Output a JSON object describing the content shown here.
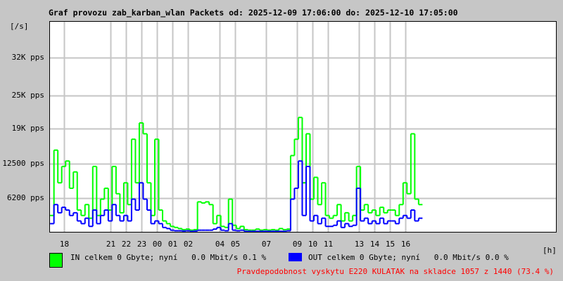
{
  "chart_data": {
    "type": "line",
    "title": "Graf provozu zab_karban_wlan Packets od: 2025-12-09 17:06:00 do: 2025-12-10 17:05:00",
    "ylabel": "[/s]",
    "xlabel": "[h]",
    "ylim": [
      0,
      38700
    ],
    "xlim_hours": [
      17.05,
      49.7
    ],
    "grid": true,
    "y_ticks": [
      {
        "value": 6200,
        "label": "6200 pps"
      },
      {
        "value": 12500,
        "label": "12500 pps"
      },
      {
        "value": 19000,
        "label": "19K pps"
      },
      {
        "value": 25000,
        "label": "25K pps"
      },
      {
        "value": 32000,
        "label": "32K pps"
      }
    ],
    "x_ticks": [
      {
        "value": 18,
        "label": "18"
      },
      {
        "value": 21,
        "label": "21"
      },
      {
        "value": 22,
        "label": "22"
      },
      {
        "value": 23,
        "label": "23"
      },
      {
        "value": 24,
        "label": "00"
      },
      {
        "value": 25,
        "label": "01"
      },
      {
        "value": 26,
        "label": "02"
      },
      {
        "value": 28,
        "label": "04"
      },
      {
        "value": 29,
        "label": "05"
      },
      {
        "value": 31,
        "label": "07"
      },
      {
        "value": 33,
        "label": "09"
      },
      {
        "value": 34,
        "label": "10"
      },
      {
        "value": 35,
        "label": "11"
      },
      {
        "value": 37,
        "label": "13"
      },
      {
        "value": 38,
        "label": "14"
      },
      {
        "value": 39,
        "label": "15"
      },
      {
        "value": 40,
        "label": "16"
      }
    ],
    "sample_start_hour": 17.1,
    "sample_step_hours": 0.25,
    "series": [
      {
        "name": "IN",
        "color": "#00ff00",
        "values": [
          3000,
          15000,
          9000,
          12000,
          13000,
          8000,
          11000,
          4000,
          3000,
          5000,
          2500,
          12000,
          3000,
          6000,
          8000,
          4000,
          12000,
          7000,
          3500,
          9000,
          5000,
          17000,
          9000,
          20000,
          18000,
          9000,
          3000,
          17000,
          4000,
          2000,
          1500,
          1000,
          800,
          600,
          400,
          500,
          300,
          400,
          5500,
          5300,
          5500,
          5000,
          1500,
          3000,
          1000,
          800,
          6000,
          1200,
          600,
          1000,
          400,
          300,
          300,
          500,
          300,
          400,
          300,
          400,
          300,
          600,
          400,
          500,
          14000,
          17000,
          21000,
          9000,
          18000,
          6000,
          10000,
          5000,
          9000,
          3000,
          2500,
          3000,
          5000,
          2000,
          3500,
          2000,
          3000,
          12000,
          4000,
          5000,
          3500,
          4000,
          3000,
          4500,
          3500,
          4000,
          4000,
          3000,
          5000,
          9000,
          7000,
          18000,
          6000,
          5000
        ]
      },
      {
        "name": "OUT",
        "color": "#0000ff",
        "values": [
          1500,
          5000,
          3500,
          4500,
          4000,
          3000,
          3500,
          2000,
          1500,
          2500,
          1000,
          4000,
          1500,
          3000,
          4000,
          2000,
          5000,
          3000,
          2000,
          3000,
          2000,
          6000,
          4000,
          9000,
          6000,
          4000,
          1500,
          2000,
          1500,
          800,
          600,
          300,
          200,
          200,
          150,
          200,
          100,
          150,
          300,
          300,
          300,
          300,
          500,
          800,
          300,
          200,
          1500,
          300,
          200,
          300,
          100,
          100,
          100,
          100,
          100,
          100,
          100,
          100,
          100,
          100,
          100,
          200,
          6000,
          8000,
          13000,
          3000,
          12000,
          2000,
          3000,
          1500,
          2500,
          1000,
          1000,
          1200,
          2000,
          800,
          1500,
          1000,
          1200,
          8000,
          2000,
          2500,
          1500,
          2000,
          1500,
          2500,
          1500,
          2000,
          2000,
          1500,
          2500,
          3000,
          2500,
          4000,
          2000,
          2500
        ]
      }
    ]
  },
  "legend": {
    "in_text": "IN celkem 0 Gbyte; nyní   0.0 Mbit/s 0.1 %",
    "out_text": "OUT celkem 0 Gbyte; nyní   0.0 Mbit/s 0.0 %"
  },
  "note": "Pravdepodobnost vyskytu E220 KULATAK na skladce 1057 z 1440 (73.4 %)",
  "colors": {
    "in": "#00ff00",
    "out": "#0000ff",
    "note": "#ff0000",
    "grid": "#c6c6c6"
  }
}
